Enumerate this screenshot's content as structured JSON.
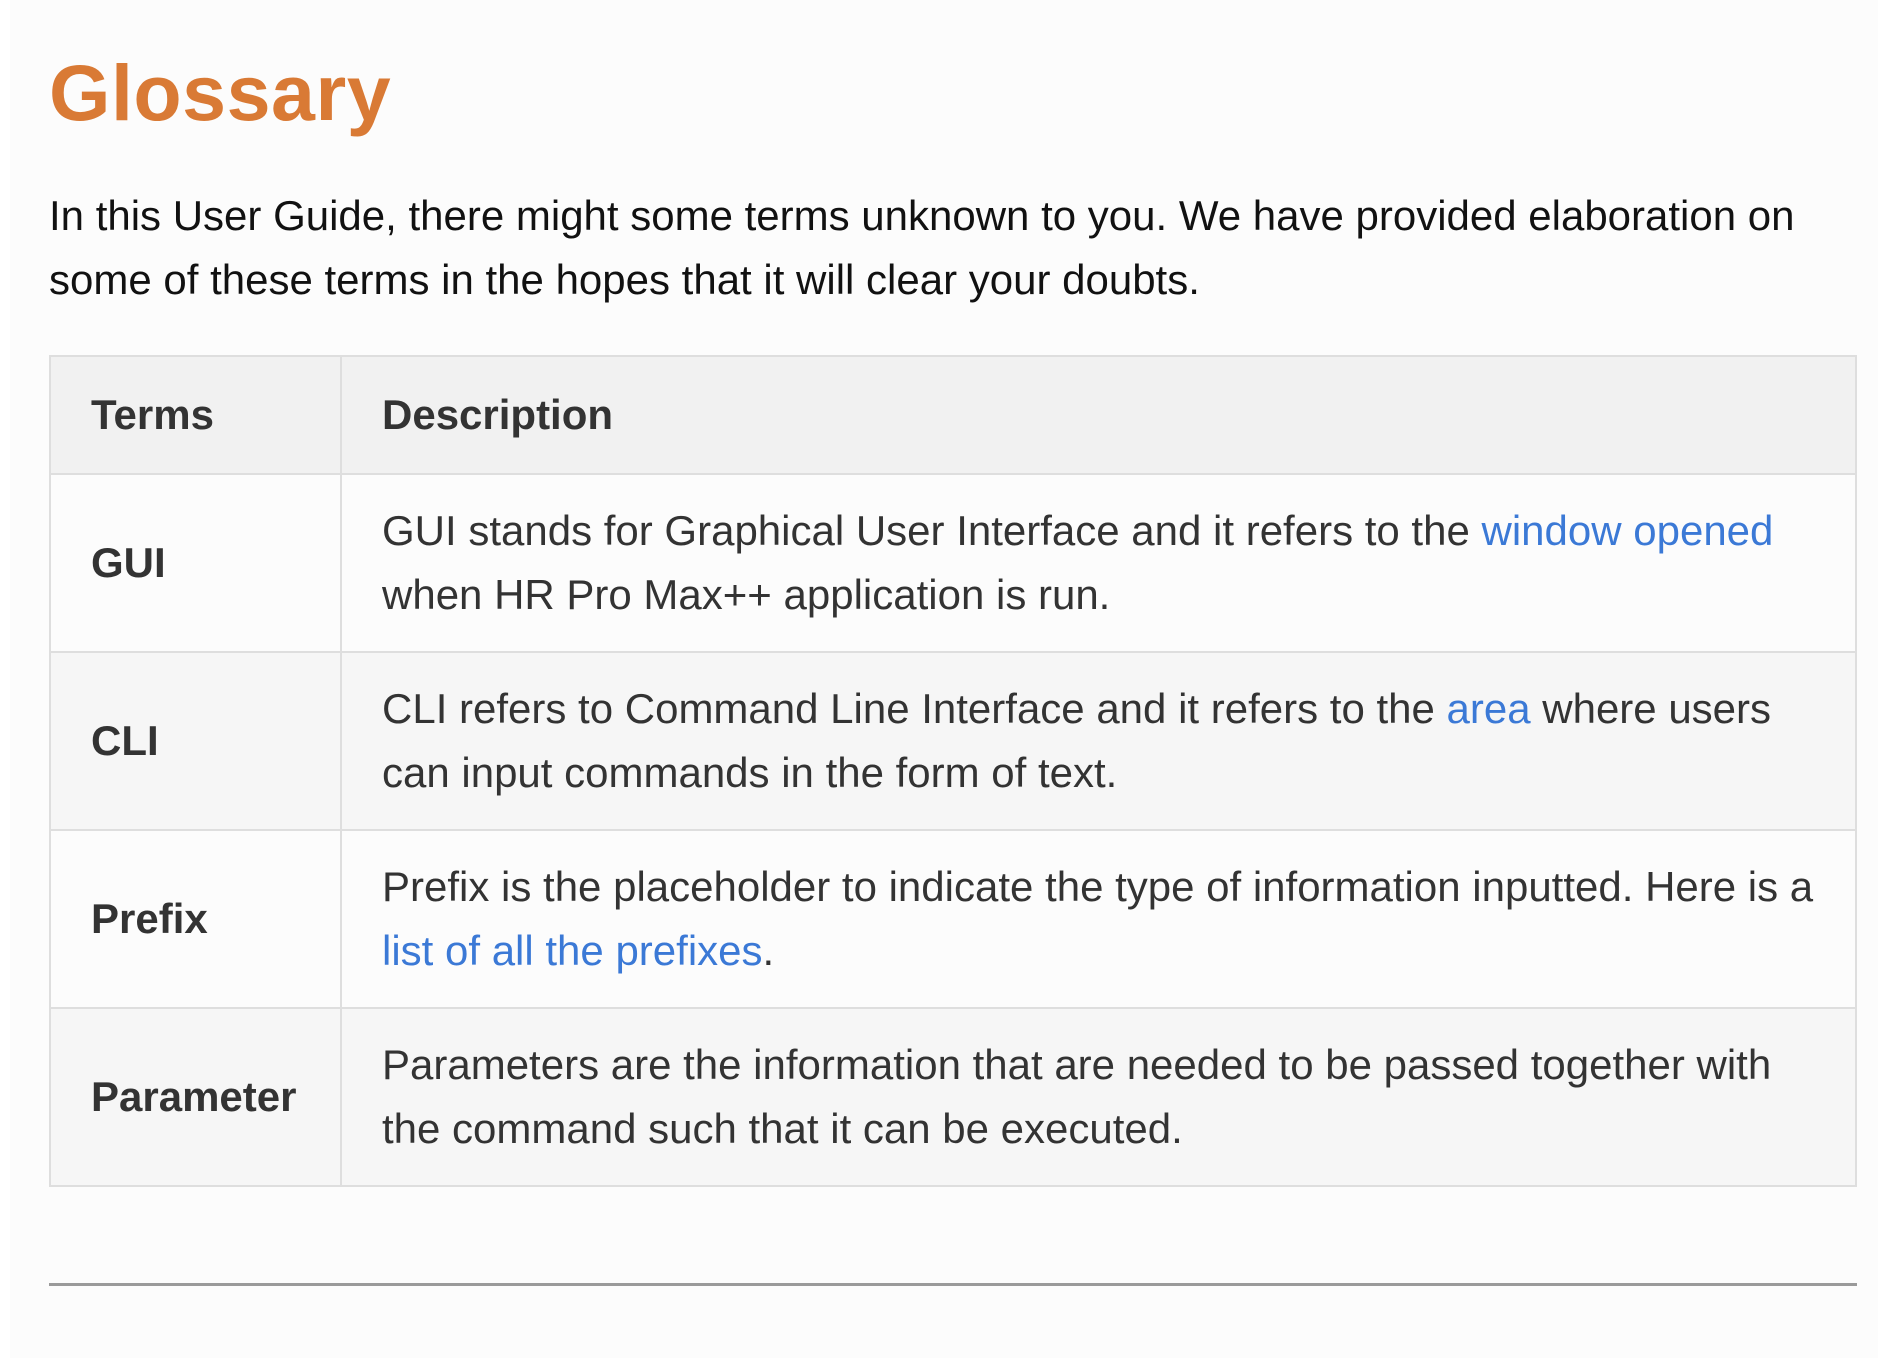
{
  "title": "Glossary",
  "intro": "In this User Guide, there might some terms unknown to you. We have provided elaboration on some of these terms in the hopes that it will clear your doubts.",
  "table": {
    "headers": [
      "Terms",
      "Description"
    ],
    "rows": [
      {
        "term": "GUI",
        "desc_before": "GUI stands for Graphical User Interface and it refers to the ",
        "link": "window opened",
        "desc_after": " when HR Pro Max++ application is run."
      },
      {
        "term": "CLI",
        "desc_before": "CLI refers to Command Line Interface and it refers to the ",
        "link": "area",
        "desc_after": " where users can input commands in the form of text."
      },
      {
        "term": "Prefix",
        "desc_before": "Prefix is the placeholder to indicate the type of information inputted. Here is a ",
        "link": "list of all the prefixes",
        "desc_after": "."
      },
      {
        "term": "Parameter",
        "desc_before": "Parameters are the information that are needed to be passed together with the command such that it can be executed."
      }
    ]
  },
  "colors": {
    "title": "#d97a35",
    "link": "#3b79d6",
    "header_bg": "#f1f1f1"
  }
}
